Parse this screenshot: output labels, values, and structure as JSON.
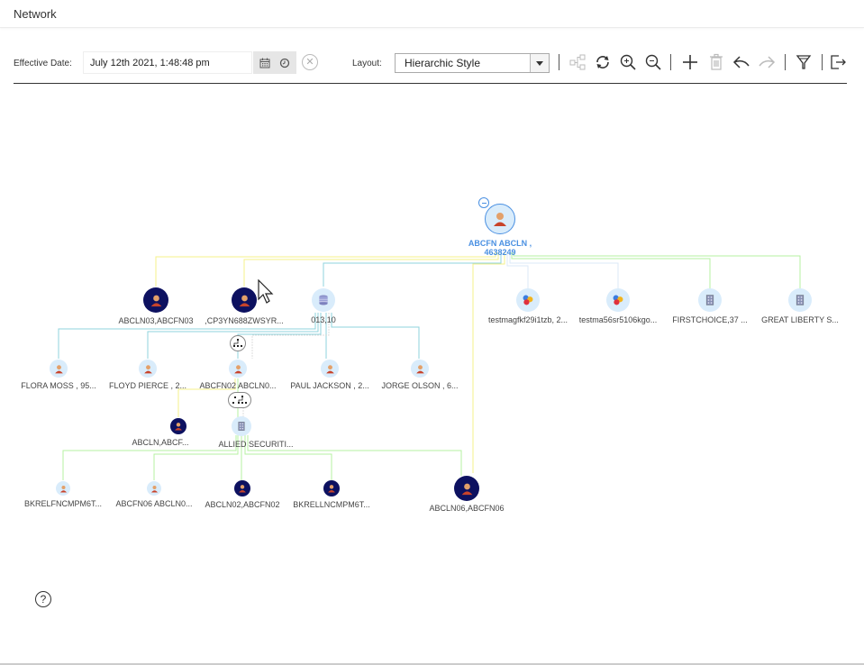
{
  "window": {
    "title": "Network"
  },
  "toolbar": {
    "effective_date_label": "Effective Date:",
    "effective_date_value": "July 12th 2021, 1:48:48 pm",
    "calendar_icon": "calendar-icon",
    "clock_icon": "clock-icon",
    "clear_icon": "clear-circle-icon",
    "layout_label": "Layout:",
    "layout_value": "Hierarchic Style",
    "actions": [
      {
        "name": "hierarchy-view",
        "icon": "hierarchy-icon",
        "enabled": false
      },
      {
        "name": "refresh",
        "icon": "refresh-icon",
        "enabled": true
      },
      {
        "name": "zoom-in",
        "icon": "zoom-in-icon",
        "enabled": true
      },
      {
        "name": "zoom-out",
        "icon": "zoom-out-icon",
        "enabled": true
      },
      {
        "name": "add",
        "icon": "plus-icon",
        "enabled": true
      },
      {
        "name": "delete",
        "icon": "trash-icon",
        "enabled": false
      },
      {
        "name": "undo",
        "icon": "undo-icon",
        "enabled": true
      },
      {
        "name": "redo",
        "icon": "redo-icon",
        "enabled": false
      },
      {
        "name": "filter",
        "icon": "filter-icon",
        "enabled": true
      },
      {
        "name": "export",
        "icon": "export-icon",
        "enabled": true
      }
    ]
  },
  "graph": {
    "root": {
      "label_line1": "ABCFN ABCLN ,",
      "label_line2": "4638249",
      "type": "person",
      "collapse_icon": "collapse-icon"
    },
    "level1": [
      {
        "label": "ABCLN03,ABCFN03",
        "type": "person-dark"
      },
      {
        "label": ",CP3YN688ZWSYR...",
        "type": "person-dark"
      },
      {
        "label": "013,10",
        "type": "database"
      },
      {
        "label": "testmagfkf29i1tzb, 2...",
        "type": "group"
      },
      {
        "label": "testma56sr5106kgo...",
        "type": "group"
      },
      {
        "label": "FIRSTCHOICE,37 ...",
        "type": "organization"
      },
      {
        "label": "GREAT LIBERTY S...",
        "type": "organization"
      }
    ],
    "level2": [
      {
        "label": "FLORA MOSS , 95...",
        "type": "person"
      },
      {
        "label": "FLOYD PIERCE , 2...",
        "type": "person"
      },
      {
        "label": "ABCFN02 ABCLN0...",
        "type": "person"
      },
      {
        "label": "PAUL JACKSON , 2...",
        "type": "person"
      },
      {
        "label": "JORGE OLSON , 6...",
        "type": "person"
      }
    ],
    "level3": [
      {
        "label": "ABCLN,ABCF...",
        "type": "person-dark"
      },
      {
        "label": "ALLIED SECURITI...",
        "type": "organization"
      }
    ],
    "level4": [
      {
        "label": "BKRELFNCMPM6T...",
        "type": "person"
      },
      {
        "label": "ABCFN06 ABCLN0...",
        "type": "person"
      },
      {
        "label": "ABCLN02,ABCFN02",
        "type": "person-dark"
      },
      {
        "label": "BKRELLNCMPM6T...",
        "type": "person-dark"
      },
      {
        "label": "ABCLN06,ABCFN06",
        "type": "person-dark"
      }
    ]
  },
  "help": {
    "icon": "help-icon",
    "text": "?"
  },
  "colors": {
    "accent": "#4a90e2",
    "dark_node": "#0d1160",
    "light_node": "#d9ecfb",
    "edge_yellow": "#f5f08a",
    "edge_teal": "#8fd3dc",
    "edge_green": "#b6f2a0"
  }
}
